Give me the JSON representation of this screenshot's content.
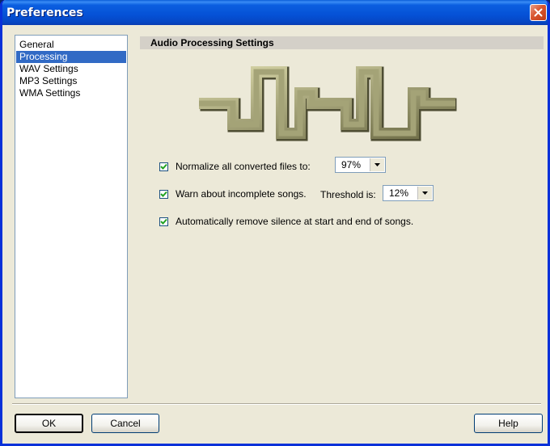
{
  "window": {
    "title": "Preferences"
  },
  "sidebar": {
    "items": [
      {
        "label": "General",
        "selected": false
      },
      {
        "label": "Processing",
        "selected": true
      },
      {
        "label": "WAV Settings",
        "selected": false
      },
      {
        "label": "MP3 Settings",
        "selected": false
      },
      {
        "label": "WMA Settings",
        "selected": false
      }
    ]
  },
  "panel": {
    "header": "Audio Processing Settings",
    "normalize": {
      "label": "Normalize all converted files to:",
      "checked": true,
      "value": "97%"
    },
    "warn": {
      "label": "Warn about incomplete songs.",
      "checked": true,
      "threshold_label": "Threshold is:",
      "value": "12%"
    },
    "silence": {
      "label": "Automatically remove silence at start and end of songs.",
      "checked": true
    }
  },
  "buttons": {
    "ok": "OK",
    "cancel": "Cancel",
    "help": "Help"
  },
  "colors": {
    "titlebar": "#0551d6",
    "selection": "#316ac5",
    "wave": "#9b9a6e"
  }
}
